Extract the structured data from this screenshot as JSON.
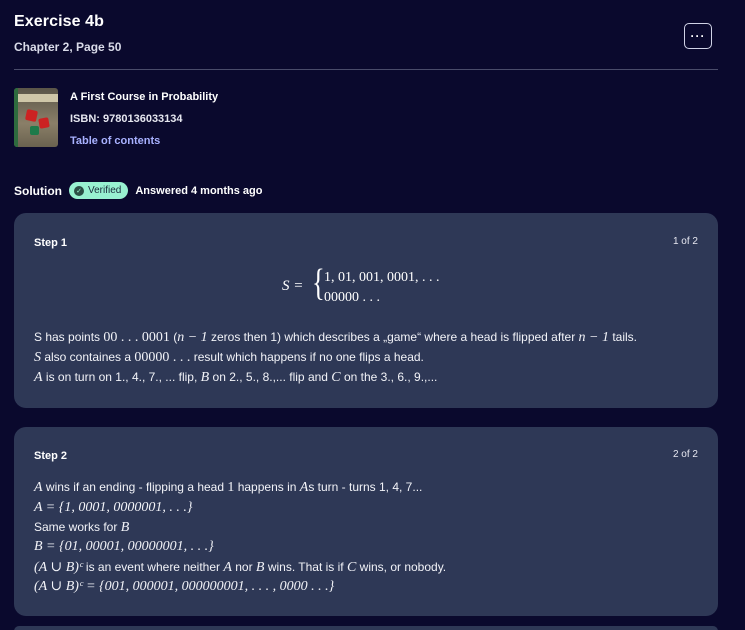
{
  "header": {
    "title": "Exercise 4b",
    "subtitle": "Chapter 2, Page 50",
    "more_label": "···"
  },
  "book": {
    "cover_text": "A First Course in PROBABILITY",
    "title": "A First Course in Probability",
    "isbn": "ISBN: 9780136033134",
    "toc_label": "Table of contents"
  },
  "solution": {
    "label": "Solution",
    "badge": "Verified",
    "answered": "Answered 4 months ago"
  },
  "steps": [
    {
      "label": "Step 1",
      "count": "1 of 2",
      "set_lhs": "S =",
      "set_line1": "1, 01, 001, 0001, . . .",
      "set_line2": "00000 . . .",
      "p1_a": "S has points ",
      "p1_m1": "00 . . . 0001",
      "p1_b": " (",
      "p1_m2": "n − 1",
      "p1_c": " zeros then 1) which describes a „game“ where a head is flipped after ",
      "p1_m3": "n − 1",
      "p1_d": " tails.",
      "p2_m1": "S",
      "p2_a": " also containes a ",
      "p2_m2": "00000 . . .",
      "p2_b": " result which happens if no one flips a head.",
      "p3_m1": "A",
      "p3_a": " is on turn on 1., 4., 7., ... flip, ",
      "p3_m2": "B",
      "p3_b": " on 2., 5., 8.,... flip and ",
      "p3_m3": "C",
      "p3_c": " on the 3., 6., 9.,..."
    },
    {
      "label": "Step 2",
      "count": "2 of 2",
      "l1_m1": "A",
      "l1_a": " wins if an ending - flipping a head ",
      "l1_m2": "1",
      "l1_b": " happens in ",
      "l1_m3": "A",
      "l1_c": "s turn - turns 1, 4, 7...",
      "l2": "A = {1, 0001, 0000001, . . .}",
      "l3_a": "Same works for ",
      "l3_m1": "B",
      "l4": "B = {01, 00001, 00000001, . . .}",
      "l5_m1": "(A ∪ B)ᶜ",
      "l5_a": " is an event where neither ",
      "l5_m2": "A",
      "l5_b": " nor ",
      "l5_m3": "B",
      "l5_c": " wins. That is if ",
      "l5_m4": "C",
      "l5_d": " wins, or nobody.",
      "l6": "(A ∪ B)ᶜ = {001, 000001, 000000001, . . . , 0000 . . .}"
    }
  ],
  "colors": {
    "background": "#0a092d",
    "card": "#2e3856",
    "badge": "#98f1d1",
    "link": "#a8b1ff"
  }
}
